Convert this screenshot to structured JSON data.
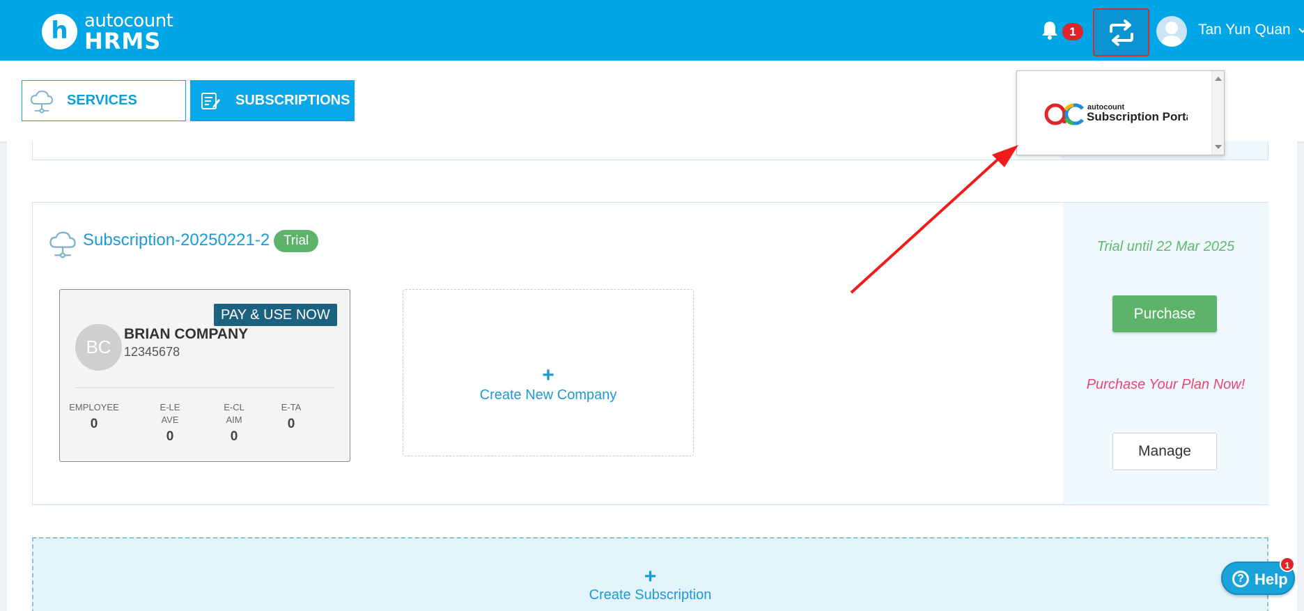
{
  "header": {
    "logo_letter": "h",
    "logo_brand": "autocount",
    "logo_product": "HRMS",
    "notifications_count": "1",
    "user_name": "Tan Yun Quan"
  },
  "tabs": [
    {
      "label": "SERVICES",
      "active": false
    },
    {
      "label": "SUBSCRIPTIONS",
      "active": true
    }
  ],
  "switch_popup": {
    "brand_small": "autocount",
    "brand_label": "Subscription Portal"
  },
  "subscription": {
    "name": "Subscription-20250221-2",
    "status": "Trial",
    "trial_until": "Trial until 22 Mar 2025",
    "purchase_label": "Purchase",
    "purchase_prompt": "Purchase Your Plan Now!",
    "manage_label": "Manage",
    "company": {
      "pay_badge": "PAY & USE NOW",
      "initials": "BC",
      "name": "BRIAN COMPANY",
      "reg_no": "12345678",
      "stats": [
        {
          "label": "EMPLOYEE",
          "value": "0"
        },
        {
          "label": "E-LEAVE",
          "value": "0"
        },
        {
          "label": "E-CLAIM",
          "value": "0"
        },
        {
          "label": "E-TA",
          "value": "0"
        }
      ]
    },
    "create_company_label": "Create New Company"
  },
  "create_subscription_label": "Create Subscription",
  "help": {
    "label": "Help",
    "badge": "1"
  },
  "colors": {
    "primary": "#00a6e6",
    "trial_green": "#5db36a",
    "alert_pink": "#e84671",
    "badge_red": "#e0242b"
  }
}
